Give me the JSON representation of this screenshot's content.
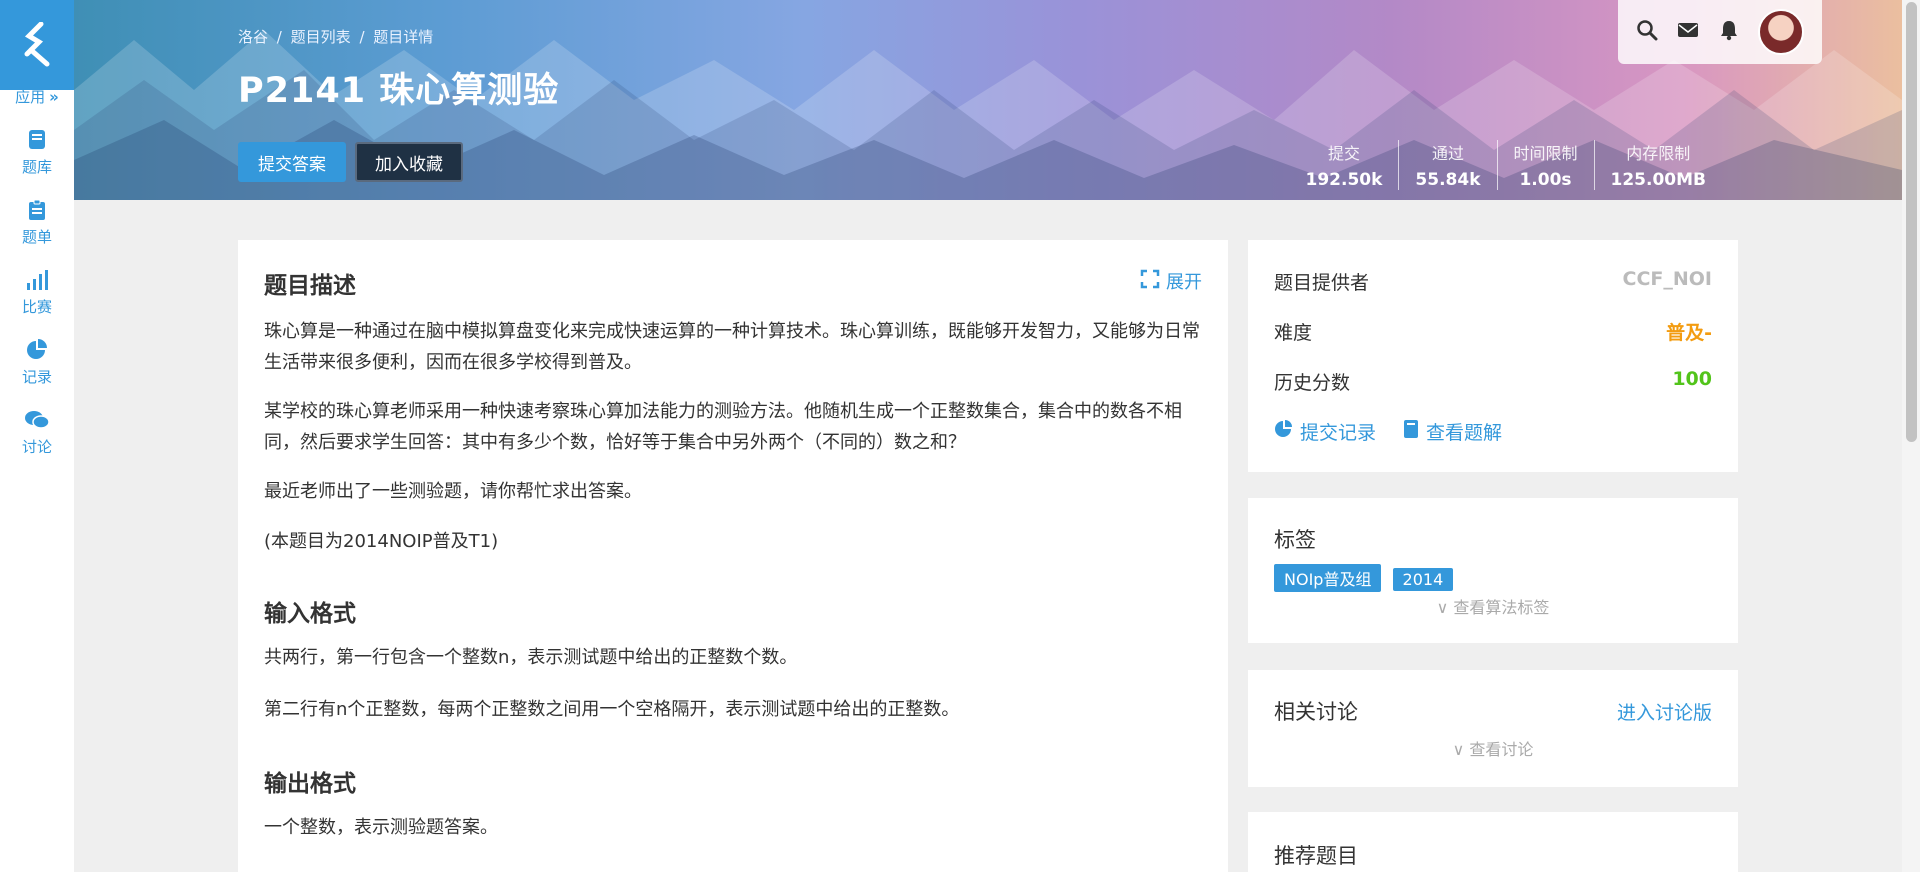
{
  "sidebar": {
    "apps_label": "应用",
    "items": [
      {
        "label": "题库",
        "icon": "book-icon"
      },
      {
        "label": "题单",
        "icon": "clipboard-icon"
      },
      {
        "label": "比赛",
        "icon": "bar-chart-icon"
      },
      {
        "label": "记录",
        "icon": "pie-chart-icon"
      },
      {
        "label": "讨论",
        "icon": "chat-icon"
      }
    ]
  },
  "header": {
    "breadcrumb": [
      "洛谷",
      "/",
      "题目列表",
      "/",
      "题目详情"
    ],
    "title": "P2141 珠心算测验",
    "submit_label": "提交答案",
    "favorite_label": "加入收藏",
    "stats": [
      {
        "label": "提交",
        "value": "192.50k"
      },
      {
        "label": "通过",
        "value": "55.84k"
      },
      {
        "label": "时间限制",
        "value": "1.00s"
      },
      {
        "label": "内存限制",
        "value": "125.00MB"
      }
    ]
  },
  "problem": {
    "expand_label": "展开",
    "desc_title": "题目描述",
    "desc_p1": "珠心算是一种通过在脑中模拟算盘变化来完成快速运算的一种计算技术。珠心算训练，既能够开发智力，又能够为日常生活带来很多便利，因而在很多学校得到普及。",
    "desc_p2": "某学校的珠心算老师采用一种快速考察珠心算加法能力的测验方法。他随机生成一个正整数集合，集合中的数各不相同，然后要求学生回答：其中有多少个数，恰好等于集合中另外两个（不同的）数之和？",
    "desc_p3": "最近老师出了一些测验题，请你帮忙求出答案。",
    "desc_p4": "(本题目为2014NOIP普及T1)",
    "input_title": "输入格式",
    "input_p1": "共两行，第一行包含一个整数n，表示测试题中给出的正整数个数。",
    "input_p2": "第二行有n个正整数，每两个正整数之间用一个空格隔开，表示测试题中给出的正整数。",
    "output_title": "输出格式",
    "output_p1": "一个整数，表示测验题答案。"
  },
  "info": {
    "provider_label": "题目提供者",
    "provider_value": "CCF_NOI",
    "difficulty_label": "难度",
    "difficulty_value": "普及-",
    "score_label": "历史分数",
    "score_value": "100",
    "records_link": "提交记录",
    "solutions_link": "查看题解",
    "colors": {
      "difficulty": "#f39c11",
      "score": "#52c41a"
    }
  },
  "tags": {
    "title": "标签",
    "items": [
      "NOIp普及组",
      "2014"
    ],
    "more": "查看算法标签"
  },
  "discussion": {
    "title": "相关讨论",
    "enter_link": "进入讨论版",
    "more": "查看讨论"
  },
  "recommend": {
    "title": "推荐题目"
  }
}
